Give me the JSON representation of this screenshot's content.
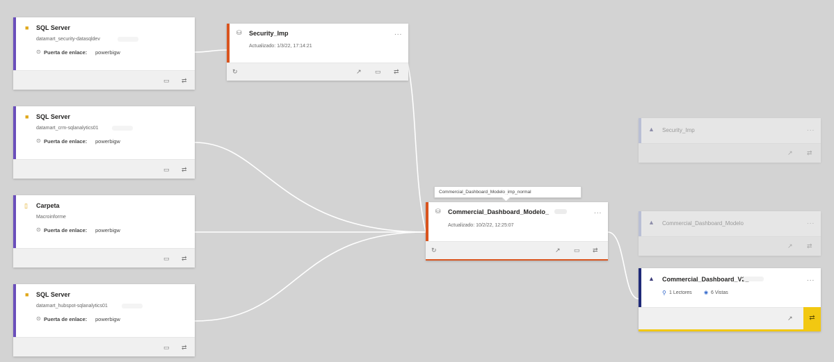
{
  "colors": {
    "sql_bar": "#6b4fbb",
    "dataset_bar": "#d9541e",
    "report_bar": "#1f2a78",
    "faded_bar": "#9aa7d9",
    "highlight": "#f2c811"
  },
  "sources": [
    {
      "type": "SQL Server",
      "name": "datamart_security-datasqldev",
      "gateway_label": "Puerta de enlace:",
      "gateway": "powerbigw",
      "icon": "database-icon"
    },
    {
      "type": "SQL Server",
      "name": "datamart_crm-sqlanalytics01",
      "gateway_label": "Puerta de enlace:",
      "gateway": "powerbigw",
      "icon": "database-icon"
    },
    {
      "type": "Carpeta",
      "name": "Macroinforme",
      "gateway_label": "Puerta de enlace:",
      "gateway": "powerbigw",
      "icon": "folder-icon"
    },
    {
      "type": "SQL Server",
      "name": "datamart_hubspot-sqlanalytics01",
      "gateway_label": "Puerta de enlace:",
      "gateway": "powerbigw",
      "icon": "database-icon"
    }
  ],
  "datasets": [
    {
      "name": "Security_Imp",
      "updated": "Actualizado: 1/3/22, 17:14:21",
      "more": "..."
    },
    {
      "name": "Commercial_Dashboard_Modelo_",
      "updated": "Actualizado: 10/2/22, 12:25:07",
      "more": "..."
    }
  ],
  "tooltip": "Commercial_Dashboard_Modelo_imp_normal",
  "reports": [
    {
      "name": "Security_Imp",
      "more": "..."
    },
    {
      "name": "Commercial_Dashboard_Modelo",
      "more": "..."
    },
    {
      "name": "Commercial_Dashboard_V2_",
      "more": "...",
      "readers": "1 Lectores",
      "views": "6 Vistas"
    }
  ],
  "glyphs": {
    "refresh": "↻",
    "open": "↗",
    "monitor": "▭",
    "lineage": "⇄",
    "gateway": "⊙",
    "person": "⚲",
    "eye": "◉"
  }
}
